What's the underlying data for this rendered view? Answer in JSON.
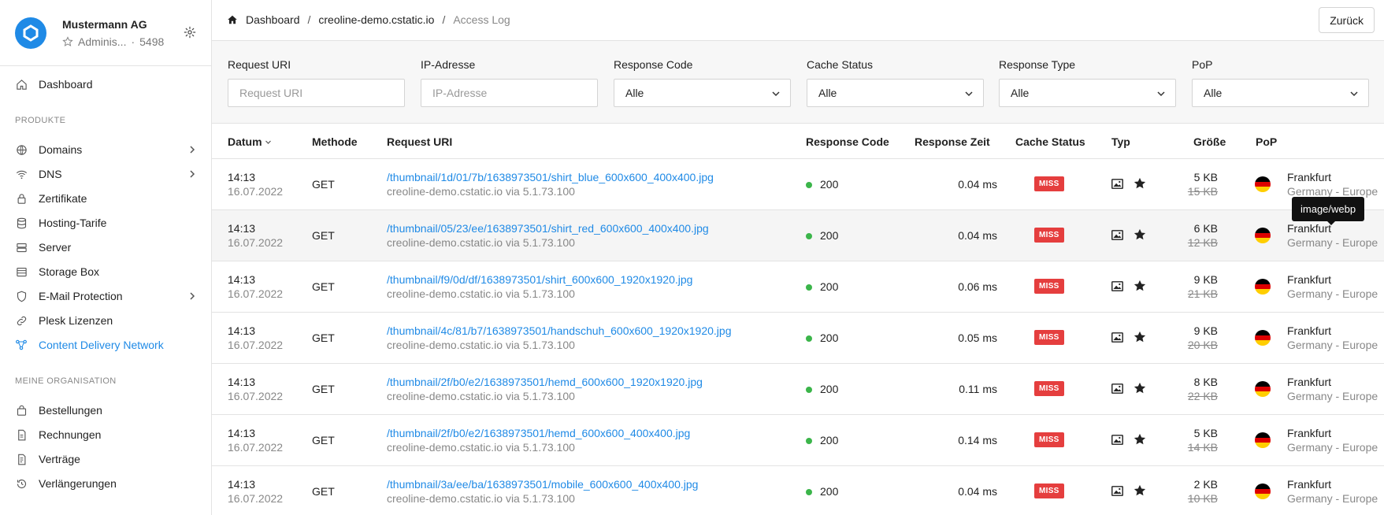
{
  "org": {
    "name": "Mustermann AG",
    "role": "Adminis...",
    "separator": "·",
    "id": "5498"
  },
  "nav": {
    "dashboard": "Dashboard",
    "section_products": "PRODUKTE",
    "domains": "Domains",
    "dns": "DNS",
    "certificates": "Zertifikate",
    "hosting": "Hosting-Tarife",
    "server": "Server",
    "storage": "Storage Box",
    "email": "E-Mail Protection",
    "plesk": "Plesk Lizenzen",
    "cdn": "Content Delivery Network",
    "section_org": "MEINE ORGANISATION",
    "orders": "Bestellungen",
    "invoices": "Rechnungen",
    "contracts": "Verträge",
    "renewals": "Verlängerungen"
  },
  "breadcrumb": {
    "home": "Dashboard",
    "sep": "/",
    "domain": "creoline-demo.cstatic.io",
    "current": "Access Log"
  },
  "back_label": "Zurück",
  "filters": {
    "request_uri": {
      "label": "Request URI",
      "placeholder": "Request URI"
    },
    "ip": {
      "label": "IP-Adresse",
      "placeholder": "IP-Adresse"
    },
    "response_code": {
      "label": "Response Code",
      "value": "Alle"
    },
    "cache_status": {
      "label": "Cache Status",
      "value": "Alle"
    },
    "response_type": {
      "label": "Response Type",
      "value": "Alle"
    },
    "pop": {
      "label": "PoP",
      "value": "Alle"
    }
  },
  "columns": {
    "date": "Datum",
    "method": "Methode",
    "uri": "Request URI",
    "code": "Response Code",
    "time": "Response Zeit",
    "cache": "Cache Status",
    "type": "Typ",
    "size": "Größe",
    "pop": "PoP"
  },
  "tooltip": "image/webp",
  "rows": [
    {
      "time": "14:13",
      "date": "16.07.2022",
      "method": "GET",
      "uri": "/thumbnail/1d/01/7b/1638973501/shirt_blue_600x600_400x400.jpg",
      "host": "creoline-demo.cstatic.io via 5.1.73.100",
      "code": "200",
      "rtime": "0.04 ms",
      "cache": "MISS",
      "size": "5 KB",
      "orig": "15 KB",
      "city": "Frankfurt",
      "region": "Germany - Europe"
    },
    {
      "time": "14:13",
      "date": "16.07.2022",
      "method": "GET",
      "uri": "/thumbnail/05/23/ee/1638973501/shirt_red_600x600_400x400.jpg",
      "host": "creoline-demo.cstatic.io via 5.1.73.100",
      "code": "200",
      "rtime": "0.04 ms",
      "cache": "MISS",
      "size": "6 KB",
      "orig": "12 KB",
      "city": "Frankfurt",
      "region": "Germany - Europe"
    },
    {
      "time": "14:13",
      "date": "16.07.2022",
      "method": "GET",
      "uri": "/thumbnail/f9/0d/df/1638973501/shirt_600x600_1920x1920.jpg",
      "host": "creoline-demo.cstatic.io via 5.1.73.100",
      "code": "200",
      "rtime": "0.06 ms",
      "cache": "MISS",
      "size": "9 KB",
      "orig": "21 KB",
      "city": "Frankfurt",
      "region": "Germany - Europe"
    },
    {
      "time": "14:13",
      "date": "16.07.2022",
      "method": "GET",
      "uri": "/thumbnail/4c/81/b7/1638973501/handschuh_600x600_1920x1920.jpg",
      "host": "creoline-demo.cstatic.io via 5.1.73.100",
      "code": "200",
      "rtime": "0.05 ms",
      "cache": "MISS",
      "size": "9 KB",
      "orig": "20 KB",
      "city": "Frankfurt",
      "region": "Germany - Europe"
    },
    {
      "time": "14:13",
      "date": "16.07.2022",
      "method": "GET",
      "uri": "/thumbnail/2f/b0/e2/1638973501/hemd_600x600_1920x1920.jpg",
      "host": "creoline-demo.cstatic.io via 5.1.73.100",
      "code": "200",
      "rtime": "0.11 ms",
      "cache": "MISS",
      "size": "8 KB",
      "orig": "22 KB",
      "city": "Frankfurt",
      "region": "Germany - Europe"
    },
    {
      "time": "14:13",
      "date": "16.07.2022",
      "method": "GET",
      "uri": "/thumbnail/2f/b0/e2/1638973501/hemd_600x600_400x400.jpg",
      "host": "creoline-demo.cstatic.io via 5.1.73.100",
      "code": "200",
      "rtime": "0.14 ms",
      "cache": "MISS",
      "size": "5 KB",
      "orig": "14 KB",
      "city": "Frankfurt",
      "region": "Germany - Europe"
    },
    {
      "time": "14:13",
      "date": "16.07.2022",
      "method": "GET",
      "uri": "/thumbnail/3a/ee/ba/1638973501/mobile_600x600_400x400.jpg",
      "host": "creoline-demo.cstatic.io via 5.1.73.100",
      "code": "200",
      "rtime": "0.04 ms",
      "cache": "MISS",
      "size": "2 KB",
      "orig": "10 KB",
      "city": "Frankfurt",
      "region": "Germany - Europe"
    }
  ]
}
